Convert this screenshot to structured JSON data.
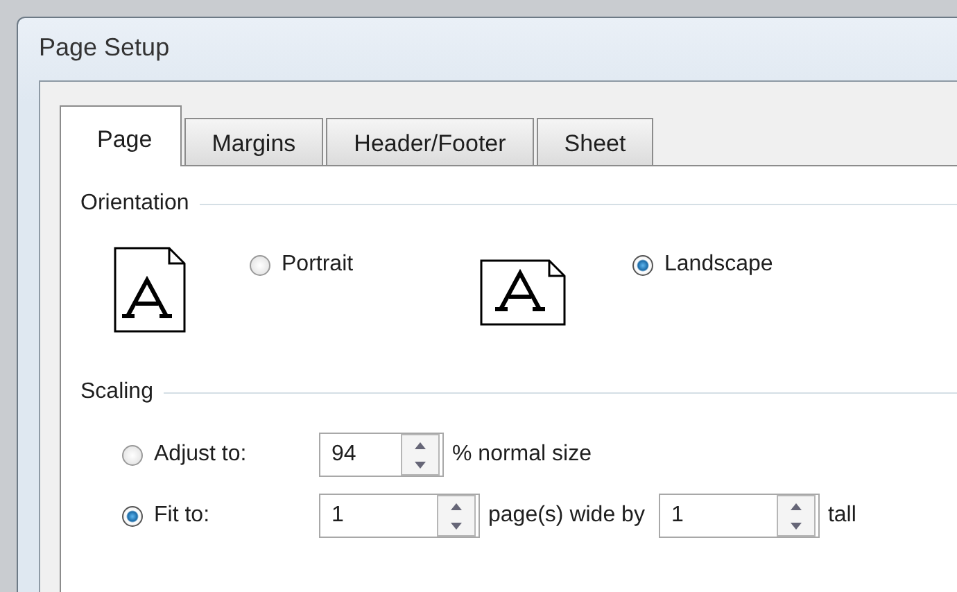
{
  "window": {
    "title": "Page Setup"
  },
  "tabs": [
    {
      "label": "Page",
      "selected": true
    },
    {
      "label": "Margins",
      "selected": false
    },
    {
      "label": "Header/Footer",
      "selected": false
    },
    {
      "label": "Sheet",
      "selected": false
    }
  ],
  "orientation": {
    "heading": "Orientation",
    "options": [
      {
        "label": "Portrait",
        "selected": false,
        "kind": "portrait"
      },
      {
        "label": "Landscape",
        "selected": true,
        "kind": "landscape"
      }
    ]
  },
  "scaling": {
    "heading": "Scaling",
    "rows": [
      {
        "label": "Adjust to:",
        "selected": false,
        "fields": [
          {
            "value": "94",
            "after": "% normal size"
          }
        ]
      },
      {
        "label": "Fit to:",
        "selected": true,
        "fields": [
          {
            "value": "1",
            "after": "page(s) wide by"
          },
          {
            "value": "1",
            "after": "tall"
          }
        ]
      }
    ]
  }
}
